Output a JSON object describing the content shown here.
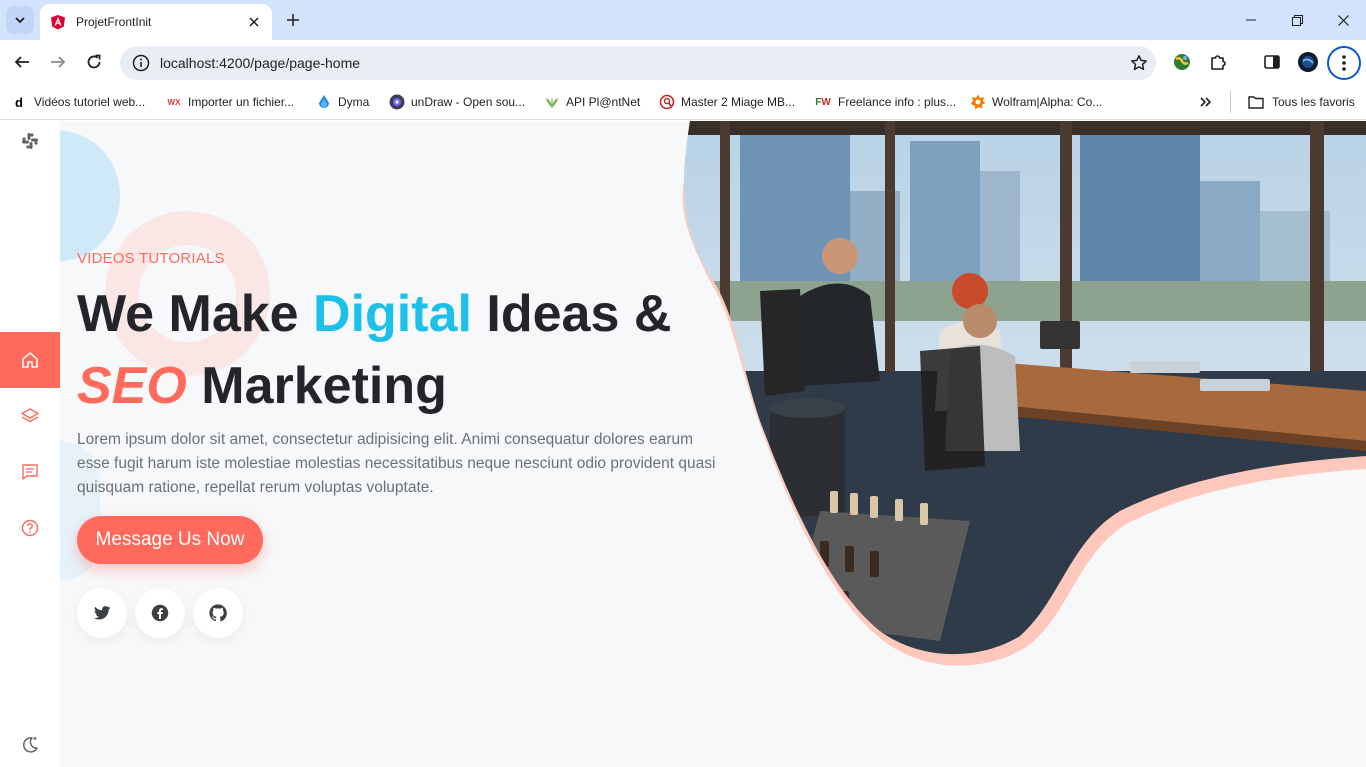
{
  "browser": {
    "tab_title": "ProjetFrontInit",
    "url": "localhost:4200/page/page-home",
    "bookmarks": [
      {
        "label": "Vidéos tutoriel web...",
        "icon": "d-icon"
      },
      {
        "label": "Importer un fichier...",
        "icon": "wx-icon"
      },
      {
        "label": "Dyma",
        "icon": "dyma-icon"
      },
      {
        "label": "unDraw - Open sou...",
        "icon": "undraw-icon"
      },
      {
        "label": "API Pl@ntNet",
        "icon": "plantnet-icon"
      },
      {
        "label": "Master 2 Miage MB...",
        "icon": "master-icon"
      },
      {
        "label": "Freelance info : plus...",
        "icon": "fw-icon"
      },
      {
        "label": "Wolfram|Alpha: Co...",
        "icon": "wolfram-icon"
      }
    ],
    "all_bookmarks_label": "Tous les favoris",
    "bookmark_icon_letters": {
      "d": "d",
      "wx": "WX",
      "fw": "FW"
    }
  },
  "sidebar": {
    "items": [
      {
        "name": "home",
        "icon": "home-icon",
        "active": true
      },
      {
        "name": "layers",
        "icon": "layers-icon",
        "active": false
      },
      {
        "name": "messages",
        "icon": "message-icon",
        "active": false
      },
      {
        "name": "help",
        "icon": "help-icon",
        "active": false
      }
    ]
  },
  "hero": {
    "eyebrow": "VIDEOS TUTORIALS",
    "headline_part1": "We Make",
    "headline_highlight": "Digital",
    "headline_part2": "Ideas &",
    "headline_seo": "SEO",
    "headline_part3": "Marketing",
    "lead": "Lorem ipsum dolor sit amet, consectetur adipisicing elit. Animi consequatur dolores earum esse fugit harum iste molestiae molestias necessitatibus neque nesciunt odio provident quasi quisquam ratione, repellat rerum voluptas voluptate.",
    "cta_label": "Message Us Now",
    "social": [
      "twitter-icon",
      "facebook-icon",
      "github-icon"
    ]
  },
  "colors": {
    "accent": "#ff6a5c",
    "highlight": "#1cc0e9",
    "text": "#23252a",
    "muted": "#6b7079",
    "blob_outline": "#ffc8bc"
  }
}
